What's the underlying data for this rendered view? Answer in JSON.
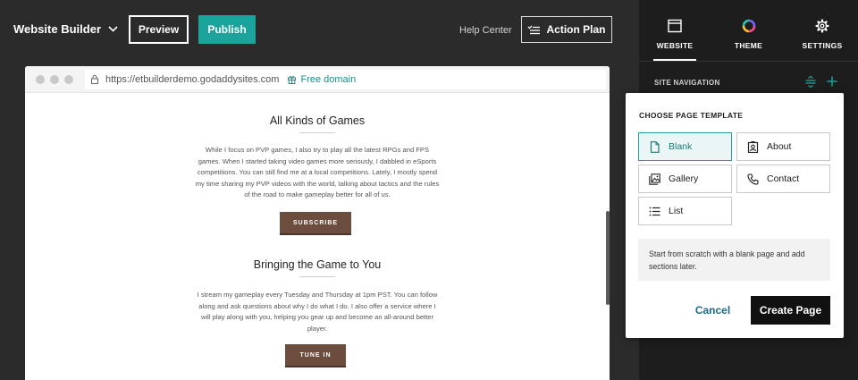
{
  "topbar": {
    "brand": "Website Builder",
    "preview_label": "Preview",
    "publish_label": "Publish",
    "help_center": "Help Center",
    "action_plan_label": "Action Plan"
  },
  "browser": {
    "url": "https://etbuilderdemo.godaddysites.com",
    "free_domain": "Free domain"
  },
  "site": {
    "sections": [
      {
        "title": "All Kinds of Games",
        "body": "While I focus on PVP games, I also try to play all the latest RPGs and FPS games. When I started taking video games more seriously, I dabbled in eSports competitions. You can still find me at a local competitions. Lately, I mostly spend my time sharing my PVP videos with the world, talking about tactics and the rules of the road to make gameplay better for all of us.",
        "button": "SUBSCRIBE"
      },
      {
        "title": "Bringing the Game to You",
        "body": "I stream my gameplay every Tuesday and Thursday at 1pm PST. You can follow along and ask questions about why I do what I do. I also offer a service where I will play along with you, helping you gear up and become an all-around better player.",
        "button": "TUNE IN"
      }
    ]
  },
  "panel": {
    "tabs": [
      {
        "label": "WEBSITE",
        "icon": "website-icon",
        "active": true
      },
      {
        "label": "THEME",
        "icon": "theme-icon",
        "active": false
      },
      {
        "label": "SETTINGS",
        "icon": "gear-icon",
        "active": false
      }
    ],
    "site_navigation_label": "SITE NAVIGATION"
  },
  "popover": {
    "title": "CHOOSE PAGE TEMPLATE",
    "templates": [
      {
        "label": "Blank",
        "icon": "blank-page-icon",
        "selected": true
      },
      {
        "label": "About",
        "icon": "about-icon",
        "selected": false
      },
      {
        "label": "Gallery",
        "icon": "gallery-icon",
        "selected": false
      },
      {
        "label": "Contact",
        "icon": "phone-icon",
        "selected": false
      },
      {
        "label": "List",
        "icon": "list-icon",
        "selected": false
      }
    ],
    "description": "Start from scratch with a blank page and add sections later.",
    "cancel_label": "Cancel",
    "create_label": "Create Page"
  },
  "colors": {
    "accent": "#1ba39c",
    "site_button": "#6d4d3e",
    "panel_bg": "#1d1d1d",
    "topbar_bg": "#2b2b2b"
  }
}
